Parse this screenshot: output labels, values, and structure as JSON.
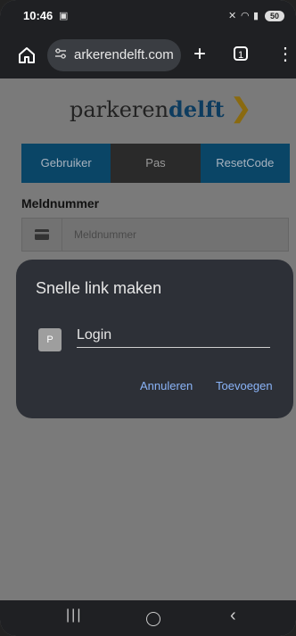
{
  "status": {
    "time": "10:46",
    "screen_record_icon": "screen-record-icon",
    "mute_icon": "mute-icon",
    "wifi_icon": "wifi-icon",
    "signal_icon": "signal-icon",
    "battery": "50"
  },
  "browser": {
    "url": "arkerendelft.com",
    "tab_count": "1",
    "home_icon": "home-icon",
    "tune_icon": "tune-icon",
    "new_tab_icon": "plus-icon",
    "menu_icon": "more-vert-icon"
  },
  "page": {
    "logo": {
      "part1": "parkeren",
      "part2": "delft",
      "chevron": "❯"
    },
    "tabs": [
      "Gebruiker",
      "Pas",
      "ResetCode"
    ],
    "field_label": "Meldnummer",
    "field_placeholder": "Meldnummer"
  },
  "dialog": {
    "title": "Snelle link maken",
    "favicon_letter": "P",
    "name_value": "Login",
    "cancel_label": "Annuleren",
    "add_label": "Toevoegen"
  },
  "colors": {
    "accent": "#8ab4f8",
    "tab_blue": "#0a4566",
    "logo_blue": "#0d3c5f",
    "logo_gold": "#8a6a10"
  }
}
